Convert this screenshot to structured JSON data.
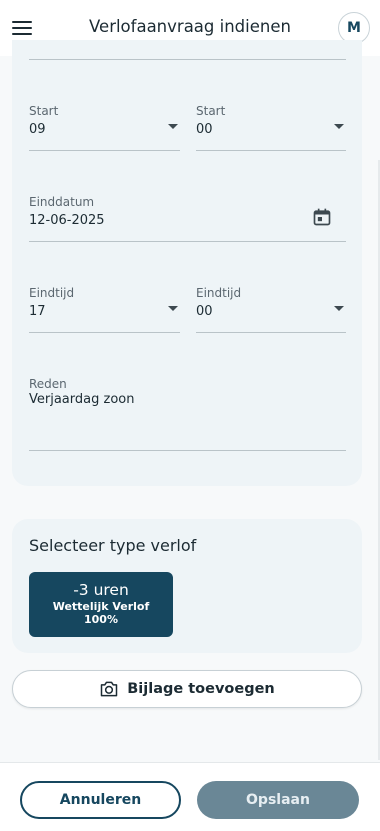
{
  "header": {
    "menu_icon": "hamburger-menu-icon",
    "title": "Verlofaanvraag indienen",
    "avatar_initial": "M"
  },
  "form": {
    "start_hour": {
      "label": "Start",
      "value": "09"
    },
    "start_minute": {
      "label": "Start",
      "value": "00"
    },
    "end_date": {
      "label": "Einddatum",
      "value": "12-06-2025",
      "icon": "calendar-icon"
    },
    "end_hour": {
      "label": "Eindtijd",
      "value": "17"
    },
    "end_minute": {
      "label": "Eindtijd",
      "value": "00"
    },
    "reason": {
      "label": "Reden",
      "value": "Verjaardag zoon"
    }
  },
  "leave_type": {
    "title": "Selecteer type verlof",
    "option": {
      "hours": "-3 uren",
      "name": "Wettelijk Verlof",
      "percentage": "100%"
    }
  },
  "attachment": {
    "label": "Bijlage toevoegen",
    "icon": "camera-icon"
  },
  "footer": {
    "cancel_label": "Annuleren",
    "save_label": "Opslaan"
  },
  "colors": {
    "primary": "#16475f",
    "save_button": "#6a8796",
    "card_background": "#eef4f7"
  }
}
